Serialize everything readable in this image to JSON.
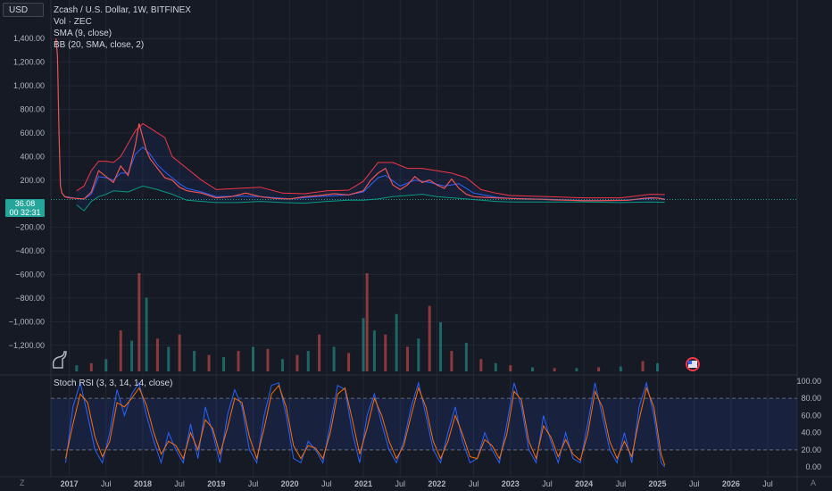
{
  "toolbar": {
    "currency": "USD",
    "auto_label": "A",
    "z_label": "Z"
  },
  "legend": {
    "title": "Zcash / U.S. Dollar, 1W, BITFINEX",
    "vol": "Vol · ZEC",
    "sma": "SMA (9, close)",
    "bb": "BB (20, SMA, close, 2)"
  },
  "last_price": {
    "value": "36.08",
    "countdown": "00 32:31"
  },
  "stoch": {
    "title": "Stoch RSI (3, 3, 14, 14, close)"
  },
  "colors": {
    "background": "#161a25",
    "grid": "#232733",
    "price": "#ef5350",
    "sma": "#2962ff",
    "bb_upper": "#f23645",
    "bb_lower": "#089981",
    "bb_fill": "#2962ff",
    "vol_up": "#26a69a",
    "vol_down": "#ef5350",
    "stoch_k": "#2962ff",
    "stoch_d": "#ff6d00"
  },
  "chart_data": [
    {
      "type": "line",
      "title": "Zcash / U.S. Dollar, 1W, BITFINEX",
      "ylim": [
        -1300,
        1500
      ],
      "yticks": [
        1400,
        1200,
        1000,
        800,
        600,
        400,
        200,
        -200,
        -400,
        -600,
        -800,
        -1000,
        -1200
      ],
      "ytick_labels": [
        "1,400.00",
        "1,200.00",
        "1,000.00",
        "800.00",
        "600.00",
        "400.00",
        "200.00",
        "−200.00",
        "−400.00",
        "−600.00",
        "−800.00",
        "−1,000.00",
        "−1,200.00"
      ],
      "xlim": [
        2016.75,
        2026.9
      ],
      "xticks": [
        {
          "x": 2017.0,
          "label": "2017"
        },
        {
          "x": 2017.5,
          "label": "Jul"
        },
        {
          "x": 2018.0,
          "label": "2018"
        },
        {
          "x": 2018.5,
          "label": "Jul"
        },
        {
          "x": 2019.0,
          "label": "2019"
        },
        {
          "x": 2019.5,
          "label": "Jul"
        },
        {
          "x": 2020.0,
          "label": "2020"
        },
        {
          "x": 2020.5,
          "label": "Jul"
        },
        {
          "x": 2021.0,
          "label": "2021"
        },
        {
          "x": 2021.5,
          "label": "Jul"
        },
        {
          "x": 2022.0,
          "label": "2022"
        },
        {
          "x": 2022.5,
          "label": "Jul"
        },
        {
          "x": 2023.0,
          "label": "2023"
        },
        {
          "x": 2023.5,
          "label": "Jul"
        },
        {
          "x": 2024.0,
          "label": "2024"
        },
        {
          "x": 2024.5,
          "label": "Jul"
        },
        {
          "x": 2025.0,
          "label": "2025"
        },
        {
          "x": 2025.5,
          "label": "Jul"
        },
        {
          "x": 2026.0,
          "label": "2026"
        },
        {
          "x": 2026.5,
          "label": "Jul"
        }
      ],
      "last_price": 36.08,
      "series": [
        {
          "name": "ZEC",
          "role": "price",
          "x": [
            2016.82,
            2016.84,
            2016.86,
            2016.88,
            2016.9,
            2016.94,
            2017.0,
            2017.1,
            2017.2,
            2017.3,
            2017.4,
            2017.5,
            2017.6,
            2017.7,
            2017.8,
            2017.9,
            2017.95,
            2018.0,
            2018.05,
            2018.1,
            2018.2,
            2018.3,
            2018.4,
            2018.5,
            2018.6,
            2018.8,
            2019.0,
            2019.2,
            2019.4,
            2019.6,
            2019.8,
            2020.0,
            2020.2,
            2020.4,
            2020.6,
            2020.8,
            2021.0,
            2021.1,
            2021.2,
            2021.3,
            2021.4,
            2021.5,
            2021.6,
            2021.7,
            2021.8,
            2021.9,
            2022.0,
            2022.1,
            2022.2,
            2022.3,
            2022.4,
            2022.5,
            2022.6,
            2022.8,
            2023.0,
            2023.2,
            2023.4,
            2023.6,
            2023.8,
            2024.0,
            2024.2,
            2024.4,
            2024.6,
            2024.8,
            2024.9,
            2025.0,
            2025.1
          ],
          "values": [
            1400,
            1250,
            600,
            150,
            90,
            60,
            50,
            45,
            40,
            100,
            280,
            230,
            180,
            320,
            240,
            500,
            680,
            560,
            450,
            380,
            300,
            220,
            200,
            140,
            110,
            90,
            50,
            60,
            90,
            60,
            45,
            40,
            60,
            70,
            85,
            75,
            110,
            200,
            260,
            300,
            160,
            120,
            160,
            230,
            180,
            200,
            160,
            130,
            210,
            130,
            80,
            60,
            55,
            50,
            45,
            40,
            38,
            33,
            30,
            25,
            25,
            28,
            30,
            45,
            50,
            48,
            36
          ]
        },
        {
          "name": "SMA",
          "role": "sma",
          "x": [
            2016.95,
            2017.1,
            2017.2,
            2017.3,
            2017.4,
            2017.5,
            2017.6,
            2017.7,
            2017.8,
            2017.9,
            2018.0,
            2018.1,
            2018.2,
            2018.3,
            2018.4,
            2018.5,
            2018.6,
            2018.8,
            2019.0,
            2019.3,
            2019.6,
            2020.0,
            2020.4,
            2020.8,
            2021.0,
            2021.2,
            2021.3,
            2021.5,
            2021.7,
            2021.9,
            2022.1,
            2022.3,
            2022.5,
            2022.8,
            2023.0,
            2023.5,
            2024.0,
            2024.5,
            2024.8,
            2025.0,
            2025.1
          ],
          "values": [
            60,
            45,
            40,
            80,
            230,
            220,
            200,
            260,
            260,
            420,
            480,
            420,
            330,
            270,
            220,
            170,
            130,
            100,
            60,
            65,
            60,
            42,
            62,
            75,
            100,
            220,
            240,
            150,
            200,
            180,
            150,
            170,
            90,
            55,
            45,
            38,
            27,
            27,
            40,
            48,
            40
          ]
        },
        {
          "name": "BB Upper",
          "role": "bb_upper",
          "x": [
            2017.1,
            2017.2,
            2017.3,
            2017.4,
            2017.5,
            2017.6,
            2017.7,
            2017.9,
            2018.0,
            2018.1,
            2018.3,
            2018.4,
            2018.6,
            2018.8,
            2019.0,
            2019.3,
            2019.6,
            2019.9,
            2020.2,
            2020.5,
            2020.8,
            2021.0,
            2021.2,
            2021.4,
            2021.6,
            2021.8,
            2022.0,
            2022.2,
            2022.4,
            2022.6,
            2022.8,
            2023.0,
            2023.5,
            2024.0,
            2024.5,
            2024.9,
            2025.1
          ],
          "values": [
            110,
            150,
            280,
            360,
            360,
            350,
            400,
            620,
            680,
            640,
            560,
            400,
            300,
            200,
            120,
            130,
            140,
            90,
            85,
            110,
            115,
            190,
            350,
            350,
            300,
            300,
            280,
            260,
            220,
            120,
            90,
            70,
            60,
            50,
            50,
            80,
            78
          ]
        },
        {
          "name": "BB Lower",
          "role": "bb_lower",
          "x": [
            2017.1,
            2017.2,
            2017.3,
            2017.4,
            2017.5,
            2017.6,
            2017.8,
            2018.0,
            2018.2,
            2018.4,
            2018.6,
            2018.8,
            2019.0,
            2019.3,
            2019.6,
            2019.9,
            2020.2,
            2020.5,
            2020.8,
            2021.0,
            2021.2,
            2021.4,
            2021.6,
            2021.8,
            2022.0,
            2022.2,
            2022.4,
            2022.6,
            2022.8,
            2023.0,
            2023.5,
            2024.0,
            2024.5,
            2024.9,
            2025.1
          ],
          "values": [
            -10,
            -60,
            20,
            60,
            80,
            110,
            100,
            150,
            120,
            80,
            30,
            20,
            10,
            10,
            20,
            10,
            5,
            20,
            30,
            30,
            40,
            60,
            70,
            80,
            60,
            50,
            40,
            30,
            20,
            15,
            15,
            15,
            10,
            15,
            12
          ]
        },
        {
          "name": "Volume",
          "role": "volume",
          "x": [
            2017.1,
            2017.3,
            2017.5,
            2017.7,
            2017.85,
            2017.95,
            2018.05,
            2018.2,
            2018.35,
            2018.5,
            2018.7,
            2018.9,
            2019.1,
            2019.3,
            2019.5,
            2019.7,
            2019.9,
            2020.1,
            2020.25,
            2020.4,
            2020.6,
            2020.8,
            2021.0,
            2021.05,
            2021.15,
            2021.3,
            2021.45,
            2021.6,
            2021.75,
            2021.9,
            2022.05,
            2022.2,
            2022.4,
            2022.6,
            2022.8,
            2023.0,
            2023.3,
            2023.6,
            2023.9,
            2024.2,
            2024.5,
            2024.8,
            2025.0
          ],
          "values": [
            15,
            20,
            30,
            100,
            75,
            240,
            180,
            80,
            60,
            90,
            50,
            40,
            35,
            50,
            60,
            55,
            30,
            40,
            50,
            90,
            60,
            45,
            130,
            240,
            100,
            90,
            140,
            60,
            80,
            160,
            120,
            50,
            70,
            30,
            20,
            15,
            10,
            8,
            8,
            10,
            12,
            25,
            20
          ]
        },
        {
          "name": "K",
          "role": "stoch_k",
          "x": [
            2016.95,
            2017.05,
            2017.15,
            2017.25,
            2017.35,
            2017.45,
            2017.55,
            2017.65,
            2017.75,
            2017.85,
            2017.95,
            2018.05,
            2018.15,
            2018.25,
            2018.35,
            2018.45,
            2018.55,
            2018.65,
            2018.75,
            2018.85,
            2018.95,
            2019.05,
            2019.15,
            2019.25,
            2019.35,
            2019.45,
            2019.55,
            2019.65,
            2019.75,
            2019.85,
            2019.95,
            2020.05,
            2020.15,
            2020.25,
            2020.35,
            2020.45,
            2020.55,
            2020.65,
            2020.75,
            2020.85,
            2020.95,
            2021.05,
            2021.15,
            2021.25,
            2021.35,
            2021.45,
            2021.55,
            2021.65,
            2021.75,
            2021.85,
            2021.95,
            2022.05,
            2022.15,
            2022.25,
            2022.35,
            2022.45,
            2022.55,
            2022.65,
            2022.75,
            2022.85,
            2022.95,
            2023.05,
            2023.15,
            2023.25,
            2023.35,
            2023.45,
            2023.55,
            2023.65,
            2023.75,
            2023.85,
            2023.95,
            2024.05,
            2024.15,
            2024.25,
            2024.35,
            2024.45,
            2024.55,
            2024.65,
            2024.75,
            2024.85,
            2024.95,
            2025.05,
            2025.1
          ],
          "values": [
            5,
            70,
            98,
            60,
            20,
            5,
            40,
            90,
            60,
            85,
            98,
            60,
            30,
            5,
            40,
            20,
            5,
            50,
            10,
            70,
            40,
            5,
            60,
            90,
            70,
            20,
            5,
            60,
            95,
            98,
            60,
            10,
            5,
            30,
            20,
            5,
            50,
            95,
            90,
            40,
            5,
            60,
            85,
            50,
            20,
            5,
            30,
            70,
            98,
            60,
            20,
            5,
            40,
            70,
            30,
            5,
            10,
            40,
            20,
            5,
            50,
            98,
            70,
            20,
            5,
            60,
            30,
            5,
            40,
            10,
            5,
            50,
            98,
            60,
            20,
            5,
            40,
            5,
            70,
            98,
            60,
            5,
            0
          ]
        },
        {
          "name": "D",
          "role": "stoch_d",
          "x": [
            2016.95,
            2017.05,
            2017.15,
            2017.25,
            2017.35,
            2017.45,
            2017.55,
            2017.65,
            2017.75,
            2017.85,
            2017.95,
            2018.05,
            2018.15,
            2018.25,
            2018.35,
            2018.45,
            2018.55,
            2018.65,
            2018.75,
            2018.85,
            2018.95,
            2019.05,
            2019.15,
            2019.25,
            2019.35,
            2019.45,
            2019.55,
            2019.65,
            2019.75,
            2019.85,
            2019.95,
            2020.05,
            2020.15,
            2020.25,
            2020.35,
            2020.45,
            2020.55,
            2020.65,
            2020.75,
            2020.85,
            2020.95,
            2021.05,
            2021.15,
            2021.25,
            2021.35,
            2021.45,
            2021.55,
            2021.65,
            2021.75,
            2021.85,
            2021.95,
            2022.05,
            2022.15,
            2022.25,
            2022.35,
            2022.45,
            2022.55,
            2022.65,
            2022.75,
            2022.85,
            2022.95,
            2023.05,
            2023.15,
            2023.25,
            2023.35,
            2023.45,
            2023.55,
            2023.65,
            2023.75,
            2023.85,
            2023.95,
            2024.05,
            2024.15,
            2024.25,
            2024.35,
            2024.45,
            2024.55,
            2024.65,
            2024.75,
            2024.85,
            2024.95,
            2025.05,
            2025.1
          ],
          "values": [
            10,
            50,
            85,
            75,
            35,
            12,
            30,
            75,
            70,
            80,
            92,
            72,
            40,
            15,
            30,
            25,
            10,
            40,
            20,
            55,
            45,
            15,
            45,
            80,
            75,
            35,
            10,
            45,
            85,
            95,
            70,
            25,
            10,
            25,
            22,
            10,
            40,
            85,
            92,
            55,
            15,
            45,
            80,
            60,
            30,
            10,
            25,
            60,
            92,
            70,
            30,
            10,
            30,
            60,
            38,
            12,
            10,
            32,
            25,
            10,
            38,
            88,
            78,
            30,
            10,
            48,
            35,
            12,
            32,
            15,
            8,
            38,
            88,
            70,
            30,
            10,
            30,
            12,
            55,
            92,
            70,
            15,
            2
          ]
        }
      ]
    },
    {
      "type": "line",
      "title": "Stoch RSI (3, 3, 14, 14, close)",
      "ylim": [
        -5,
        103
      ],
      "yticks": [
        100,
        80,
        60,
        40,
        20,
        0
      ],
      "ytick_labels": [
        "100.00",
        "80.00",
        "60.00",
        "40.00",
        "20.00",
        "0.00"
      ],
      "bands": [
        20,
        80
      ]
    }
  ]
}
